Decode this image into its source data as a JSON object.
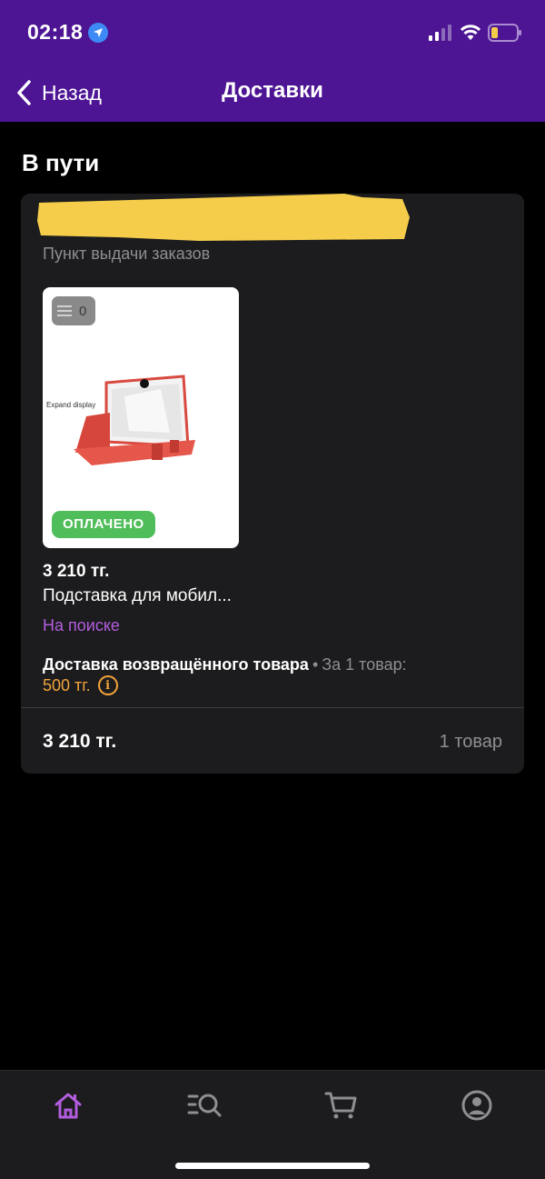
{
  "status_bar": {
    "time": "02:18"
  },
  "nav": {
    "back_label": "Назад",
    "title": "Доставки"
  },
  "section": {
    "title": "В пути"
  },
  "order": {
    "pickup_label": "Пункт выдачи заказов",
    "item_count_badge": "0",
    "paid_badge": "ОПЛАЧЕНО",
    "product_image_caption": "Expand display",
    "price": "3 210 тг.",
    "product_name": "Подставка для мобил...",
    "status": "На поиске",
    "delivery_label": "Доставка возвращённого товара",
    "delivery_separator": "•",
    "delivery_per": "За 1 товар:",
    "delivery_fee": "500 тг.",
    "total": "3 210 тг.",
    "items_count": "1 товар"
  },
  "tabbar": {
    "items": [
      {
        "icon": "home-icon",
        "active": true
      },
      {
        "icon": "catalog-search-icon",
        "active": false
      },
      {
        "icon": "cart-icon",
        "active": false
      },
      {
        "icon": "profile-icon",
        "active": false
      }
    ]
  },
  "colors": {
    "header_bg": "#4d1594",
    "accent_purple": "#b25dde",
    "paid_green": "#4fbd5a",
    "fee_orange": "#f2a33a",
    "redaction_yellow": "#f5cd4b"
  }
}
